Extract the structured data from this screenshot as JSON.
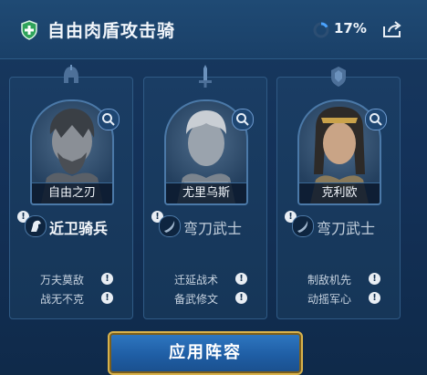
{
  "header": {
    "title": "自由肉盾攻击骑",
    "progress_text": "17%",
    "progress_value": 0.17
  },
  "cards": [
    {
      "hero_name": "自由之刃",
      "unit_label": "近卫骑兵",
      "unit_active": true,
      "skills": [
        "万夫莫敌",
        "战无不克"
      ],
      "emblem_icon": "helmet-emblem-icon"
    },
    {
      "hero_name": "尤里乌斯",
      "unit_label": "弯刀武士",
      "unit_active": false,
      "skills": [
        "迁延战术",
        "备武修文"
      ],
      "emblem_icon": "sword-emblem-icon"
    },
    {
      "hero_name": "克利欧",
      "unit_label": "弯刀武士",
      "unit_active": false,
      "skills": [
        "制敌机先",
        "动摇军心"
      ],
      "emblem_icon": "crest-emblem-icon"
    }
  ],
  "footer": {
    "apply_label": "应用阵容"
  },
  "colors": {
    "accent_gold": "#d8b24c",
    "button_blue": "#2f78c2",
    "progress_blue": "#4aa3ff"
  }
}
